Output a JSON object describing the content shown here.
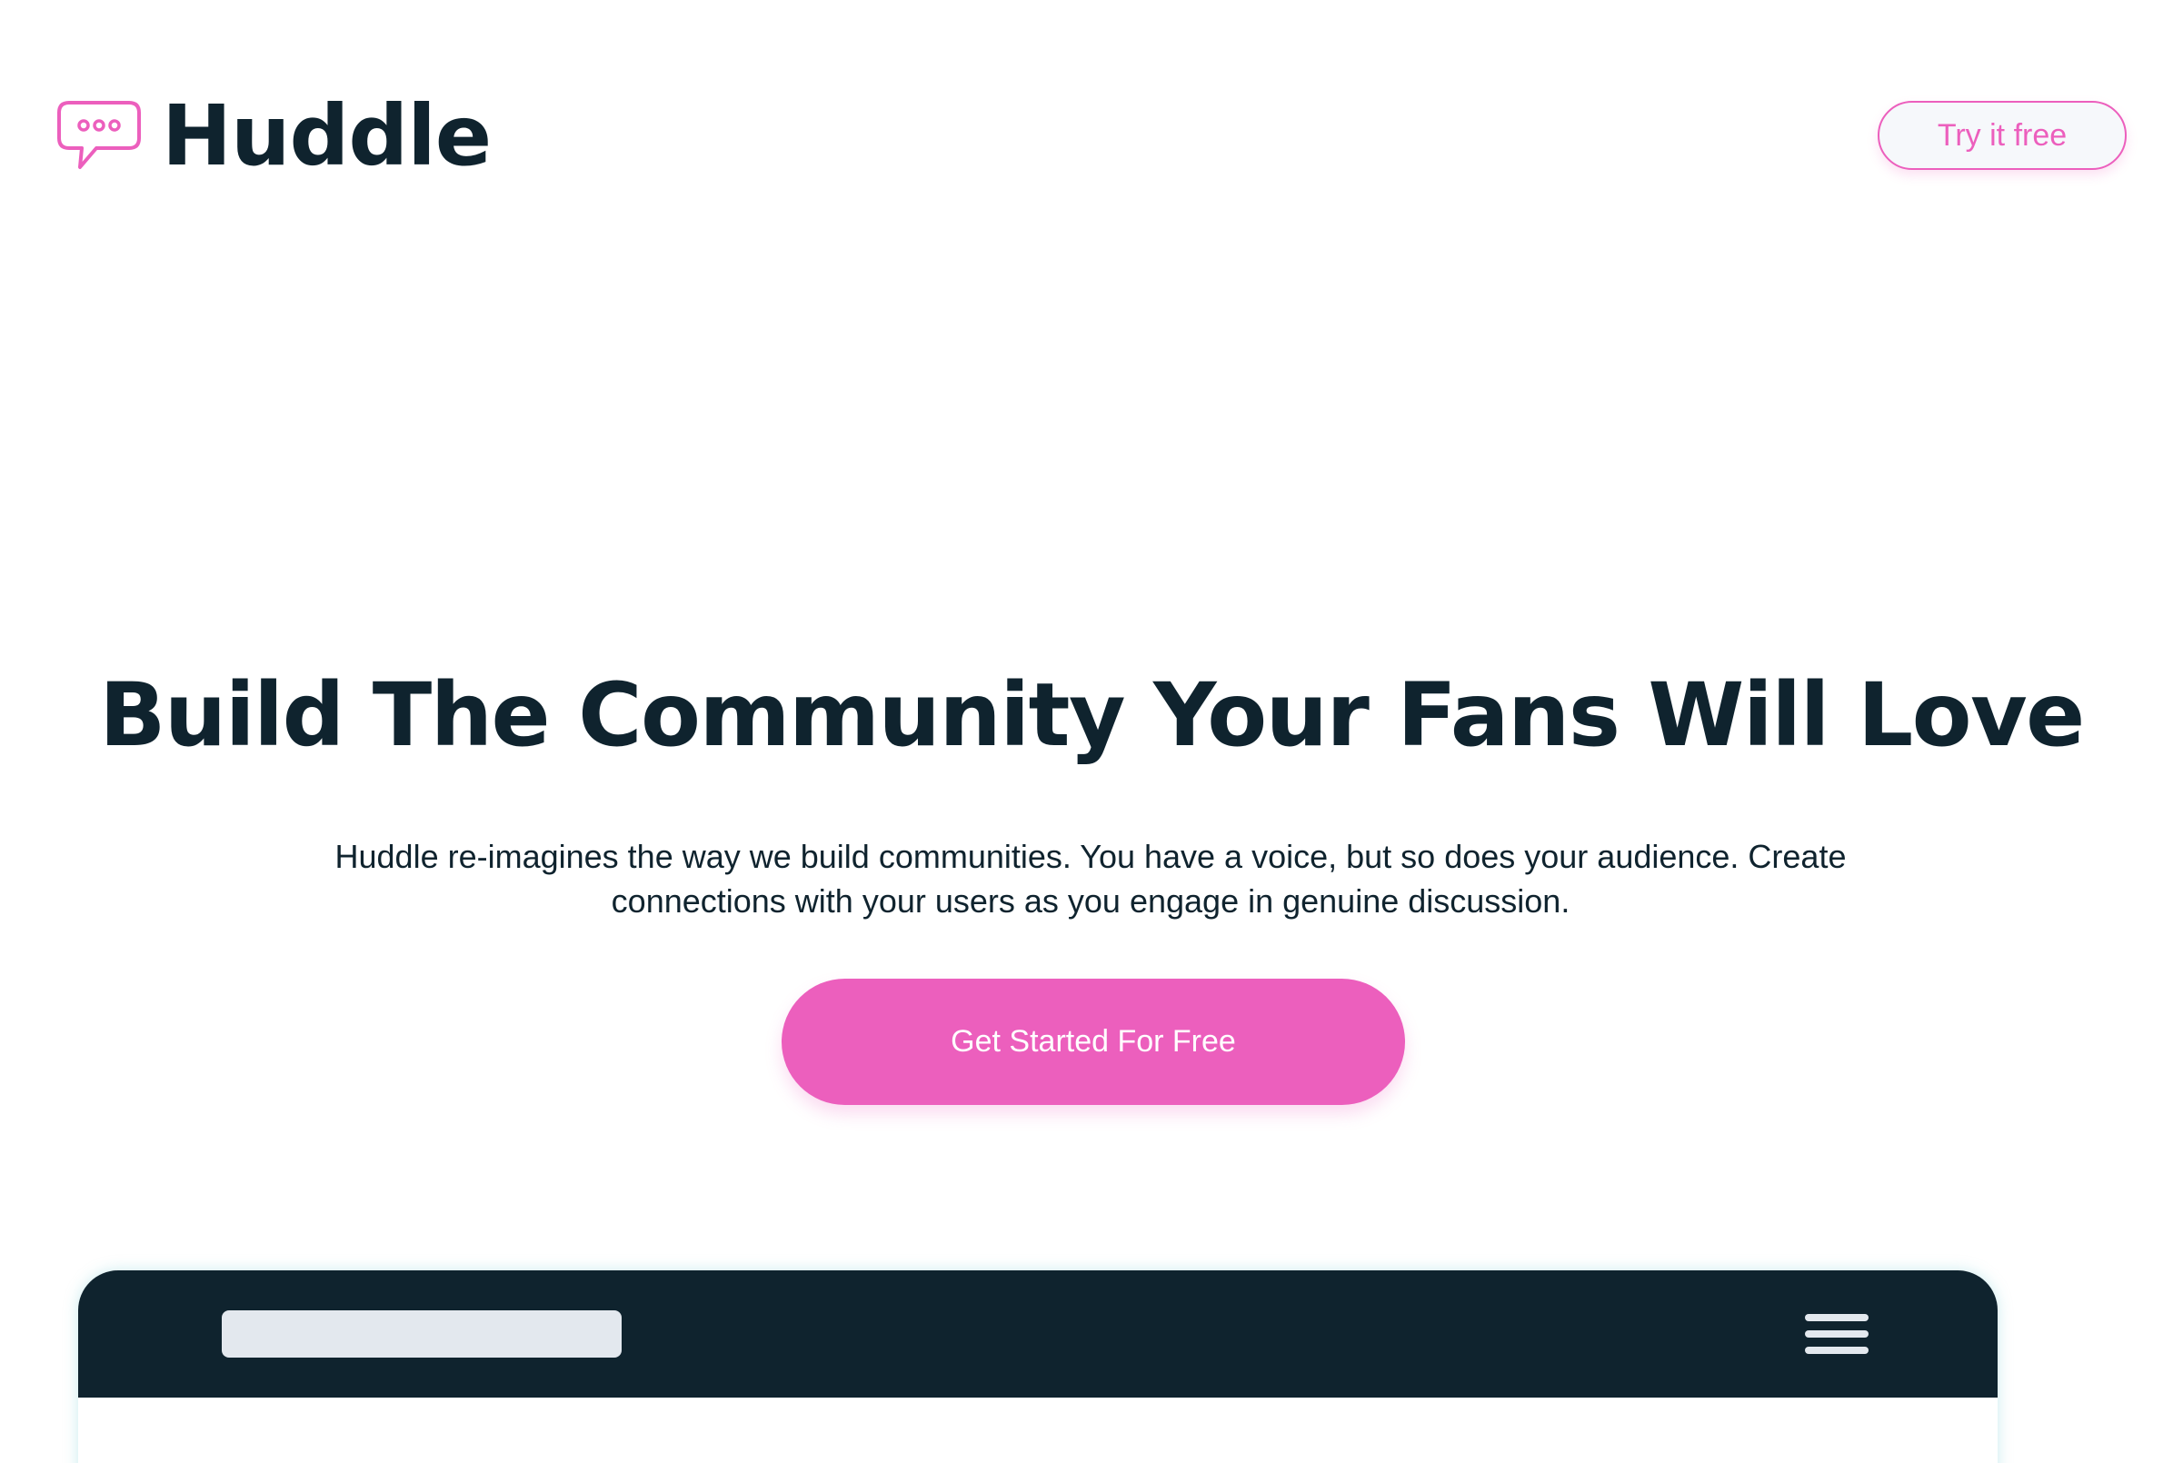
{
  "brand": {
    "name": "Huddle",
    "icon": "chat-bubble-icon",
    "accent_color": "#ec5fbd",
    "dark_color": "#0f232e"
  },
  "header": {
    "cta_label": "Try it free"
  },
  "hero": {
    "title": "Build The Community Your Fans Will Love",
    "description": "Huddle re-imagines the way we build communities. You have a voice, but so does your audience. Create connections with your users as you engage in genuine discussion.",
    "cta_label": "Get Started For Free"
  },
  "mockup": {
    "menu_icon": "hamburger-menu-icon"
  }
}
